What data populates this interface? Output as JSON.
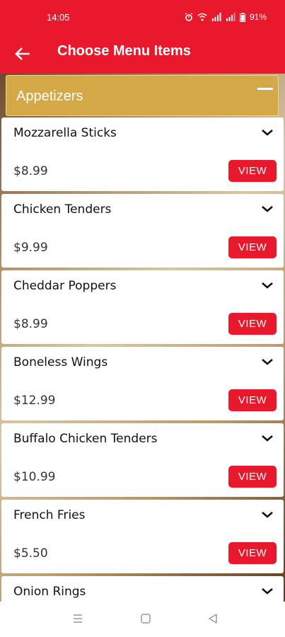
{
  "status": {
    "time": "14:05",
    "battery": "91%"
  },
  "appbar": {
    "title": "Choose Menu Items"
  },
  "category": {
    "label": "Appetizers"
  },
  "items": [
    {
      "name": "Mozzarella Sticks",
      "price": "$8.99",
      "button": "VIEW"
    },
    {
      "name": "Chicken Tenders",
      "price": "$9.99",
      "button": "VIEW"
    },
    {
      "name": "Cheddar Poppers",
      "price": "$8.99",
      "button": "VIEW"
    },
    {
      "name": "Boneless Wings",
      "price": "$12.99",
      "button": "VIEW"
    },
    {
      "name": "Buffalo Chicken Tenders",
      "price": "$10.99",
      "button": "VIEW"
    },
    {
      "name": "French Fries",
      "price": "$5.50",
      "button": "VIEW"
    },
    {
      "name": "Onion Rings",
      "price": "",
      "button": ""
    }
  ],
  "colors": {
    "brand_red": "#e8192c",
    "category_gold": "#d4a747"
  },
  "icons": [
    "back-arrow-icon",
    "collapse-minus-icon",
    "chevron-down-icon",
    "alarm-icon",
    "wifi-icon",
    "signal-icon",
    "battery-icon",
    "recent-apps-icon",
    "home-icon",
    "back-triangle-icon"
  ]
}
